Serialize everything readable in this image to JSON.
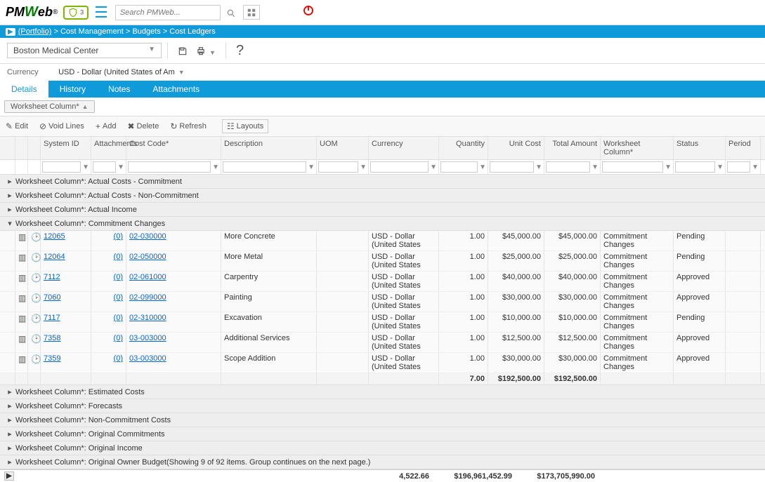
{
  "header": {
    "search_placeholder": "Search PMWeb..."
  },
  "breadcrumb": {
    "p1": "(Portfolio)",
    "p2": "Cost Management",
    "p3": "Budgets",
    "p4": "Cost Ledgers"
  },
  "project": {
    "name": "Boston Medical Center"
  },
  "currency": {
    "label": "Currency",
    "value": "USD - Dollar (United States of Am"
  },
  "tabs": {
    "details": "Details",
    "history": "History",
    "notes": "Notes",
    "attachments": "Attachments"
  },
  "group_pill": "Worksheet Column*",
  "toolbar": {
    "edit": "Edit",
    "void": "Void Lines",
    "add": "Add",
    "delete": "Delete",
    "refresh": "Refresh",
    "layouts": "Layouts"
  },
  "cols": {
    "sys": "System ID",
    "att": "Attachments",
    "cc": "Cost Code*",
    "desc": "Description",
    "uom": "UOM",
    "cur": "Currency",
    "qty": "Quantity",
    "ucost": "Unit Cost",
    "tot": "Total Amount",
    "wc": "Worksheet Column*",
    "stat": "Status",
    "per": "Period"
  },
  "groups": {
    "g1": "Worksheet Column*: Actual Costs - Commitment",
    "g2": "Worksheet Column*: Actual Costs - Non-Commitment",
    "g3": "Worksheet Column*: Actual Income",
    "g4": "Worksheet Column*: Commitment Changes",
    "g5": "Worksheet Column*: Estimated Costs",
    "g6": "Worksheet Column*: Forecasts",
    "g7": "Worksheet Column*: Non-Commitment Costs",
    "g8": "Worksheet Column*: Original Commitments",
    "g9": "Worksheet Column*: Original Income",
    "g10": "Worksheet Column*: Original Owner Budget(Showing 9 of 92 items. Group continues on the next page.)"
  },
  "rows": [
    {
      "sys": "12065",
      "att": "(0)",
      "cc": "02-030000",
      "desc": "More Concrete",
      "cur": "USD - Dollar (United States",
      "qty": "1.00",
      "ucost": "$45,000.00",
      "tot": "$45,000.00",
      "wc": "Commitment Changes",
      "stat": "Pending"
    },
    {
      "sys": "12064",
      "att": "(0)",
      "cc": "02-050000",
      "desc": "More Metal",
      "cur": "USD - Dollar (United States",
      "qty": "1.00",
      "ucost": "$25,000.00",
      "tot": "$25,000.00",
      "wc": "Commitment Changes",
      "stat": "Pending"
    },
    {
      "sys": "7112",
      "att": "(0)",
      "cc": "02-061000",
      "desc": "Carpentry",
      "cur": "USD - Dollar (United States",
      "qty": "1.00",
      "ucost": "$40,000.00",
      "tot": "$40,000.00",
      "wc": "Commitment Changes",
      "stat": "Approved"
    },
    {
      "sys": "7060",
      "att": "(0)",
      "cc": "02-099000",
      "desc": "Painting",
      "cur": "USD - Dollar (United States",
      "qty": "1.00",
      "ucost": "$30,000.00",
      "tot": "$30,000.00",
      "wc": "Commitment Changes",
      "stat": "Approved"
    },
    {
      "sys": "7117",
      "att": "(0)",
      "cc": "02-310000",
      "desc": "Excavation",
      "cur": "USD - Dollar (United States",
      "qty": "1.00",
      "ucost": "$10,000.00",
      "tot": "$10,000.00",
      "wc": "Commitment Changes",
      "stat": "Pending"
    },
    {
      "sys": "7358",
      "att": "(0)",
      "cc": "03-003000",
      "desc": "Additional Services",
      "cur": "USD - Dollar (United States",
      "qty": "1.00",
      "ucost": "$12,500.00",
      "tot": "$12,500.00",
      "wc": "Commitment Changes",
      "stat": "Approved"
    },
    {
      "sys": "7359",
      "att": "(0)",
      "cc": "03-003000",
      "desc": "Scope Addition",
      "cur": "USD - Dollar (United States",
      "qty": "1.00",
      "ucost": "$30,000.00",
      "tot": "$30,000.00",
      "wc": "Commitment Changes",
      "stat": "Approved"
    }
  ],
  "group_total": {
    "qty": "7.00",
    "ucost": "$192,500.00",
    "tot": "$192,500.00"
  },
  "footer": {
    "qty": "4,522.66",
    "ucost": "$196,961,452.99",
    "tot": "$173,705,990.00"
  }
}
